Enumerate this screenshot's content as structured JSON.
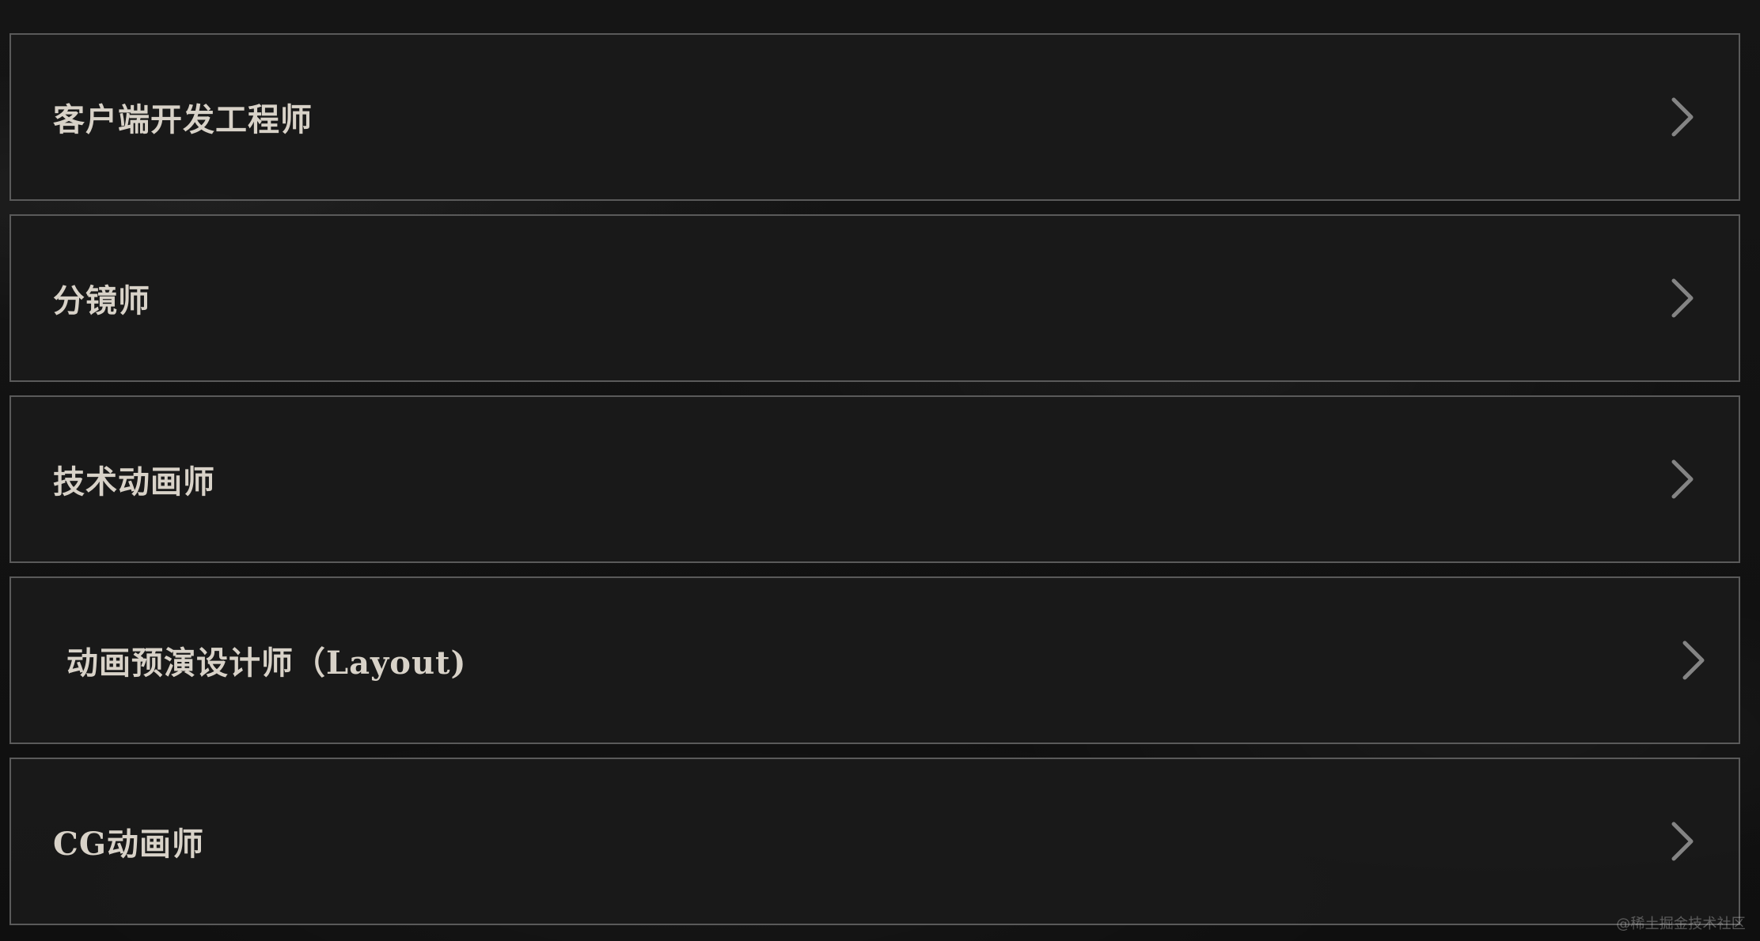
{
  "jobs": [
    {
      "title": "客户端开发工程师",
      "action_icon": "chevron-right-icon"
    },
    {
      "title": "分镜师",
      "action_icon": "chevron-right-icon"
    },
    {
      "title": "技术动画师",
      "action_icon": "chevron-right-icon"
    },
    {
      "title": " 动画预演设计师（Layout)",
      "action_icon": "chevron-right-icon"
    },
    {
      "title": "CG动画师",
      "action_icon": "chevron-right-icon"
    }
  ],
  "watermark": "@稀土掘金技术社区",
  "colors": {
    "background": "#121212",
    "card": "#1a1a1a",
    "border": "#5a5a5a",
    "text": "#d8d2c8",
    "chevron": "#8a8a8a"
  }
}
